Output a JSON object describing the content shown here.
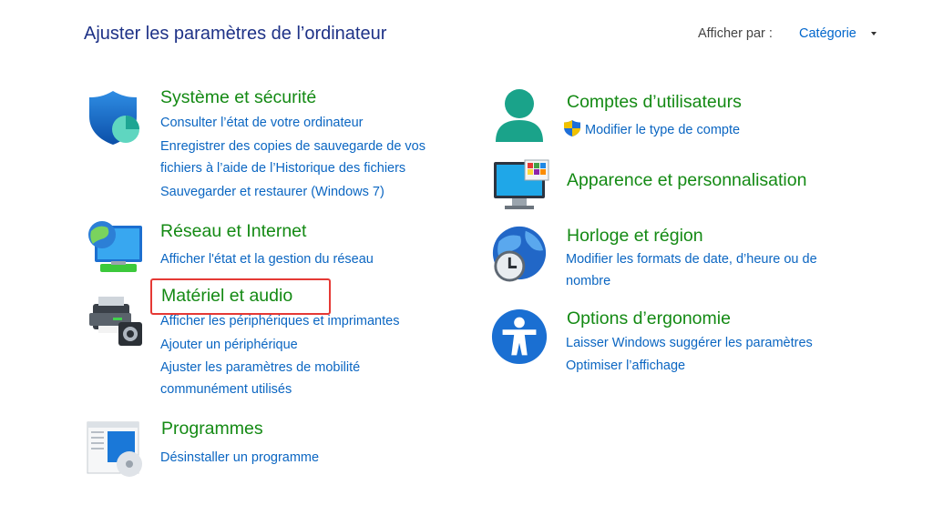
{
  "header": {
    "title": "Ajuster les paramètres de l’ordinateur",
    "view_by_label": "Afficher par :",
    "view_by_value": "Catégorie"
  },
  "left_categories": [
    {
      "title": "Système et sécurité",
      "links": [
        "Consulter l’état de votre ordinateur",
        "Enregistrer des copies de sauvegarde de vos",
        "fichiers à l’aide de l’Historique des fichiers",
        "Sauvegarder et restaurer (Windows 7)"
      ]
    },
    {
      "title": "Réseau et Internet",
      "links": [
        "Afficher l'état et la gestion du réseau"
      ]
    },
    {
      "title": "Matériel et audio",
      "links": [
        "Afficher les périphériques et imprimantes",
        "Ajouter un périphérique",
        "Ajuster les paramètres de mobilité",
        "communément utilisés"
      ]
    },
    {
      "title": "Programmes",
      "links": [
        "Désinstaller un programme"
      ]
    }
  ],
  "right_categories": [
    {
      "title": "Comptes d’utilisateurs",
      "links": [
        "Modifier le type de compte"
      ]
    },
    {
      "title": "Apparence et personnalisation",
      "links": []
    },
    {
      "title": "Horloge et région",
      "links": [
        "Modifier les formats de date, d’heure ou de",
        "nombre"
      ]
    },
    {
      "title": "Options d’ergonomie",
      "links": [
        "Laisser Windows suggérer les paramètres",
        "Optimiser l’affichage"
      ]
    }
  ],
  "colors": {
    "category_green": "#148a14",
    "link_blue": "#0b66c2",
    "title_navy": "#1e3287",
    "highlight_red": "#e53935"
  }
}
